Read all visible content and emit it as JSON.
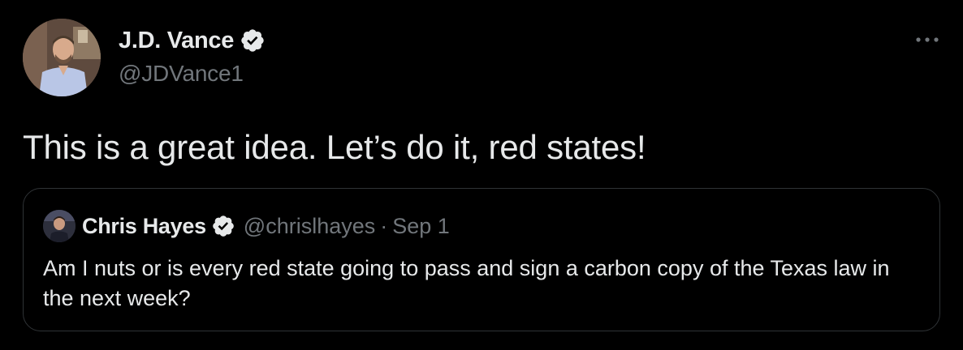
{
  "tweet": {
    "author": {
      "name": "J.D. Vance",
      "handle": "@JDVance1",
      "verified": true
    },
    "text": "This is a great idea. Let’s do it, red states!",
    "more_icon": "more-horizontal-icon"
  },
  "quoted_tweet": {
    "author": {
      "name": "Chris Hayes",
      "handle": "@chrislhayes",
      "verified": true
    },
    "separator": "·",
    "date": "Sep 1",
    "text": "Am I nuts or is every red state going to pass and sign a carbon copy of the Texas law in the next week?"
  },
  "colors": {
    "background": "#000000",
    "primary_text": "#e7e9ea",
    "secondary_text": "#71767b",
    "border": "#2f3336",
    "verified_badge": "#e7e9ea"
  }
}
